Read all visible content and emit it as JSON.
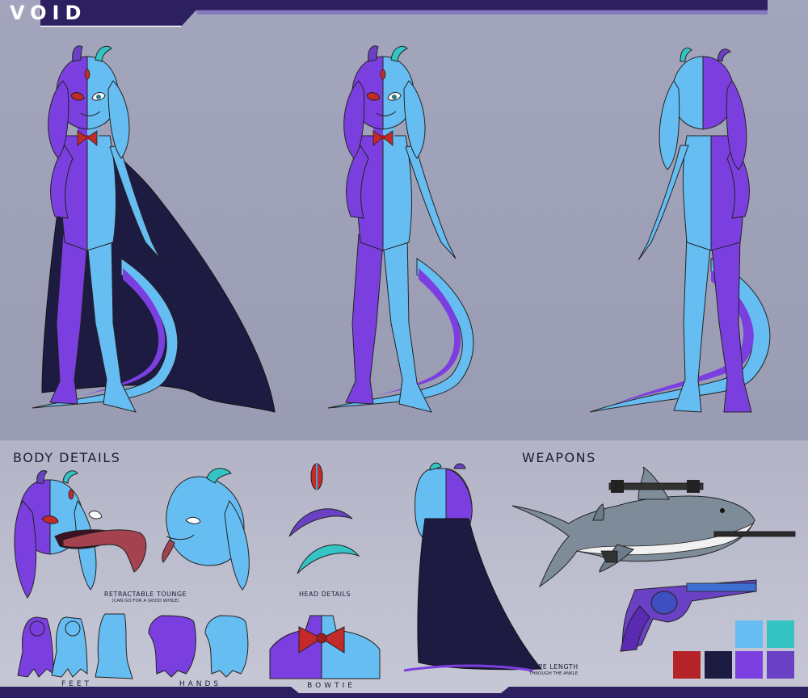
{
  "title": "VOID",
  "sections": {
    "body_details": "BODY DETAILS",
    "weapons": "WEAPONS"
  },
  "captions": {
    "tongue_main": "RETRACTABLE TOUNGE",
    "tongue_sub": "(CAN GO FOR A GOOD WHILE)",
    "head_details": "HEAD DETAILS",
    "feet": "FEET",
    "hands": "HANDS",
    "bowtie": "BOWTIE",
    "cape_main": "CAPE LENGTH",
    "cape_sub": "THROUGH THE ANKLE"
  },
  "colors": {
    "background": "#9d9fb6",
    "purple_body": "#7b3fe0",
    "blue_body": "#66bdf2",
    "teal_fin": "#34c4c4",
    "cape": "#1d1b42",
    "bowtie": "#c42a2a",
    "title_bar": "#3a2a78"
  },
  "palette": [
    "#66bdf2",
    "#34c4c4",
    "#b52328",
    "#1d1b42",
    "#7b3fe0",
    "#6a41c4"
  ],
  "figures": [
    {
      "name": "front-with-cape",
      "view": "front",
      "cape": true
    },
    {
      "name": "front",
      "view": "front",
      "cape": false
    },
    {
      "name": "back",
      "view": "back",
      "cape": false
    }
  ],
  "weapons": [
    "shark-rifle",
    "revolver"
  ]
}
